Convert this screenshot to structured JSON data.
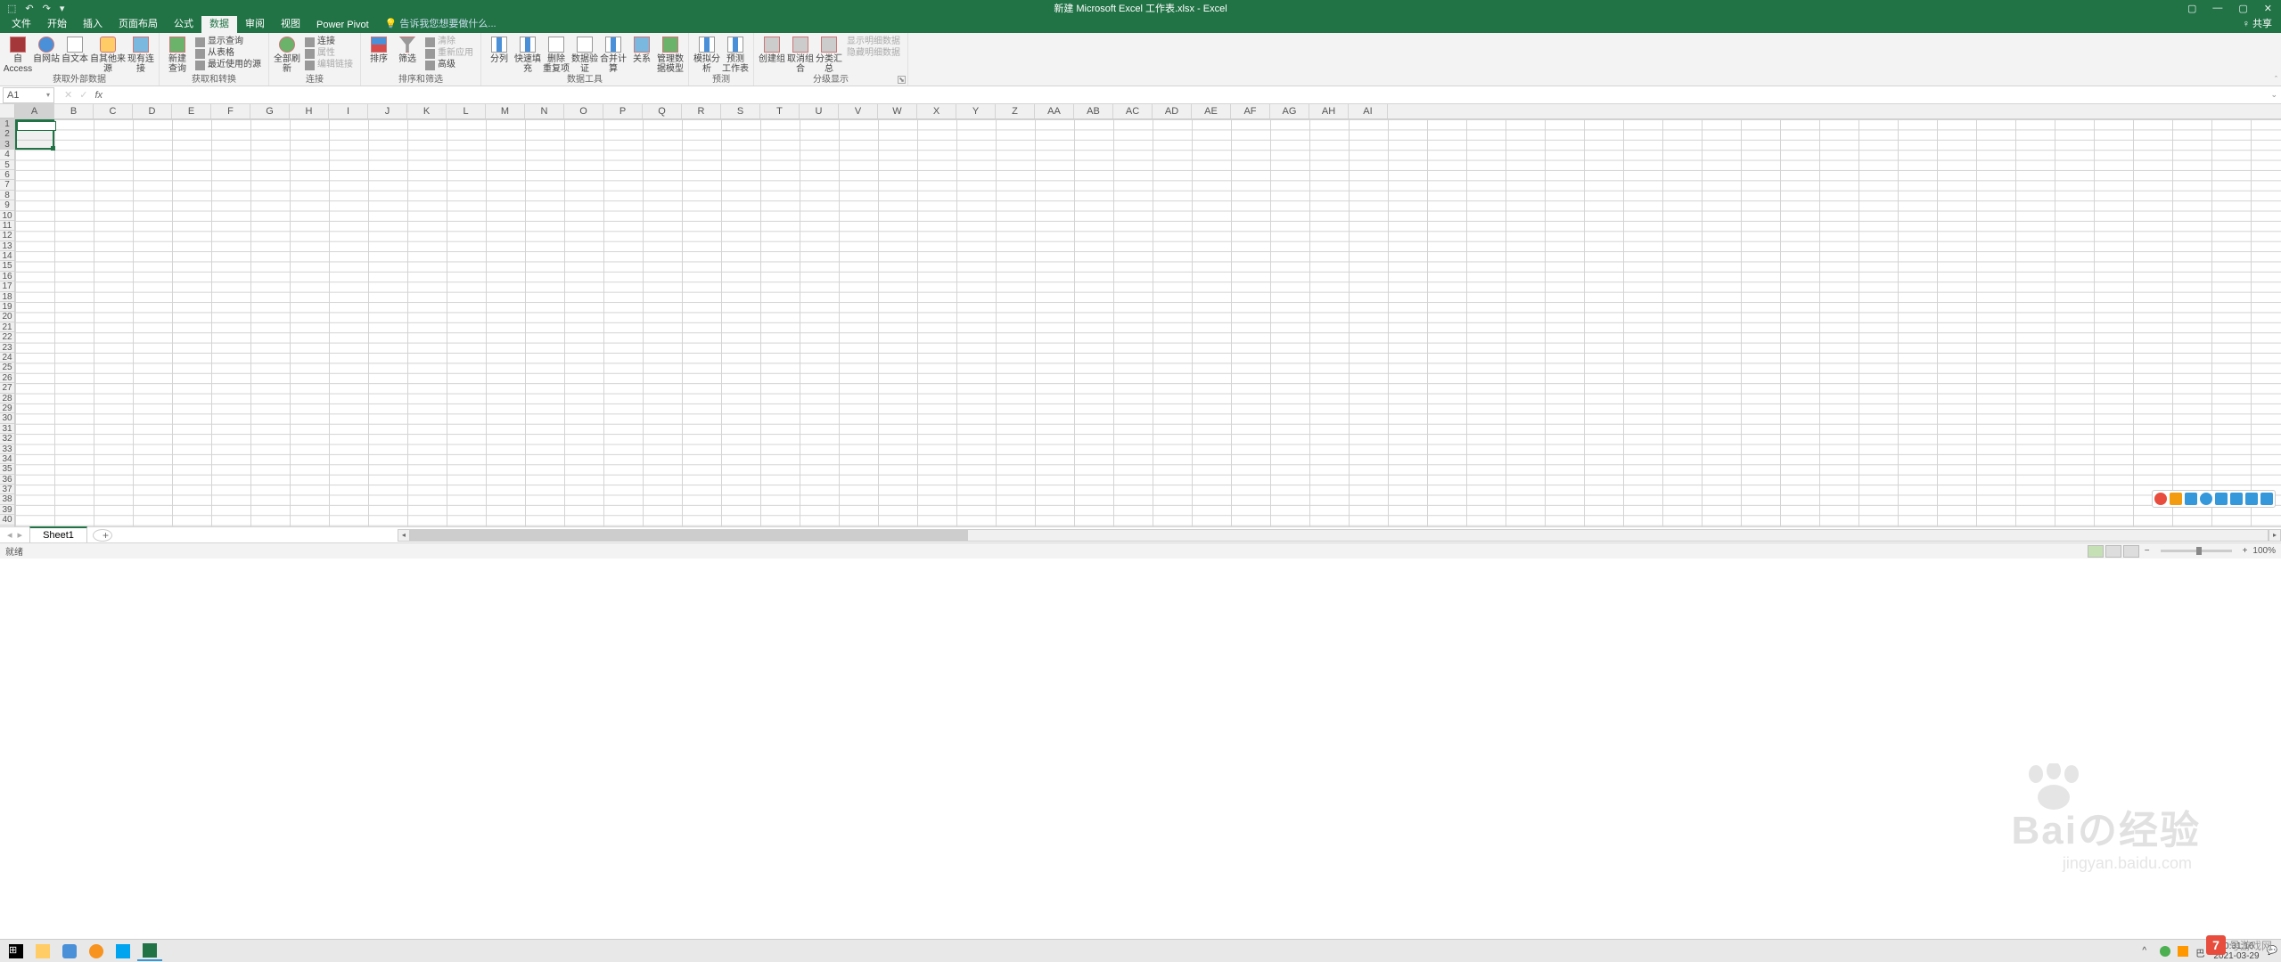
{
  "title": "新建 Microsoft Excel 工作表.xlsx - Excel",
  "qat": {
    "undo": "↶",
    "redo": "↷",
    "save": "💾"
  },
  "tabs": [
    "文件",
    "开始",
    "插入",
    "页面布局",
    "公式",
    "数据",
    "审阅",
    "视图",
    "Power Pivot"
  ],
  "active_tab": "数据",
  "tellme": "告诉我您想要做什么...",
  "share": "共享",
  "ribbon": {
    "group1": {
      "label": "获取外部数据",
      "btns": [
        "自 Access",
        "自网站",
        "自文本",
        "自其他来源",
        "现有连接"
      ]
    },
    "group2": {
      "label": "获取和转换",
      "main": "新建\n查询",
      "items": [
        "显示查询",
        "从表格",
        "最近使用的源"
      ]
    },
    "group3": {
      "label": "连接",
      "main": "全部刷新",
      "items": [
        "连接",
        "属性",
        "编辑链接"
      ]
    },
    "group4": {
      "label": "排序和筛选",
      "sort": "排序",
      "filter": "筛选",
      "items": [
        "清除",
        "重新应用",
        "高级"
      ]
    },
    "group5": {
      "label": "数据工具",
      "btns": [
        "分列",
        "快速填充",
        "删除\n重复项",
        "数据验\n证",
        "合并计算",
        "关系",
        "管理数\n据模型"
      ]
    },
    "group6": {
      "label": "预测",
      "btns": [
        "模拟分析",
        "预测\n工作表"
      ]
    },
    "group7": {
      "label": "分级显示",
      "btns": [
        "创建组",
        "取消组合",
        "分类汇总"
      ],
      "items": [
        "显示明细数据",
        "隐藏明细数据"
      ]
    }
  },
  "namebox": "A1",
  "columns": [
    "A",
    "B",
    "C",
    "D",
    "E",
    "F",
    "G",
    "H",
    "I",
    "J",
    "K",
    "L",
    "M",
    "N",
    "O",
    "P",
    "Q",
    "R",
    "S",
    "T",
    "U",
    "V",
    "W",
    "X",
    "Y",
    "Z",
    "AA",
    "AB",
    "AC",
    "AD",
    "AE",
    "AF",
    "AG",
    "AH",
    "AI"
  ],
  "row_count": 40,
  "sheet": "Sheet1",
  "status": "就绪",
  "zoom": "100%",
  "watermark": {
    "main": "Baiの经验",
    "sub": "jingyan.baidu.com",
    "logo": "7",
    "logotext": "号游戏网"
  },
  "tray": {
    "time": "10:31:16",
    "date": "2021-03-29"
  }
}
